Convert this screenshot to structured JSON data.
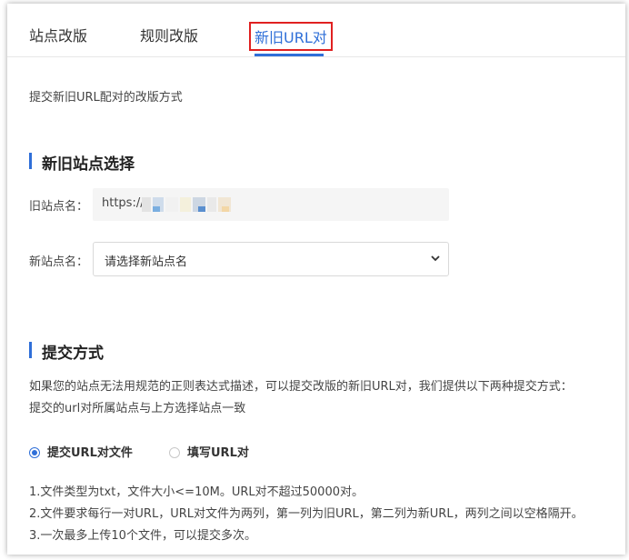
{
  "tabs": [
    {
      "label": "站点改版"
    },
    {
      "label": "规则改版"
    },
    {
      "label": "新旧URL对"
    }
  ],
  "description": "提交新旧URL配对的改版方式",
  "section_site": {
    "title": "新旧站点选择",
    "old_label": "旧站点名：",
    "old_value": "https://z",
    "new_label": "新站点名：",
    "new_placeholder": "请选择新站点名"
  },
  "section_submit": {
    "title": "提交方式",
    "paragraph": [
      "如果您的站点无法用规范的正则表达式描述，可以提交改版的新旧URL对，我们提供以下两种提交方式：",
      "提交的url对所属站点与上方选择站点一致"
    ],
    "options": [
      {
        "label": "提交URL对文件",
        "selected": true
      },
      {
        "label": "填写URL对",
        "selected": false
      }
    ],
    "rules": [
      "1.文件类型为txt，文件大小<=10M。URL对不超过50000对。",
      "2.文件要求每行一对URL，URL对文件为两列，第一列为旧URL，第二列为新URL，两列之间以空格隔开。",
      "3.一次最多上传10个文件，可以提交多次。"
    ]
  },
  "colors": {
    "accent": "#2f6fd8",
    "highlight_box": "#e02020"
  }
}
